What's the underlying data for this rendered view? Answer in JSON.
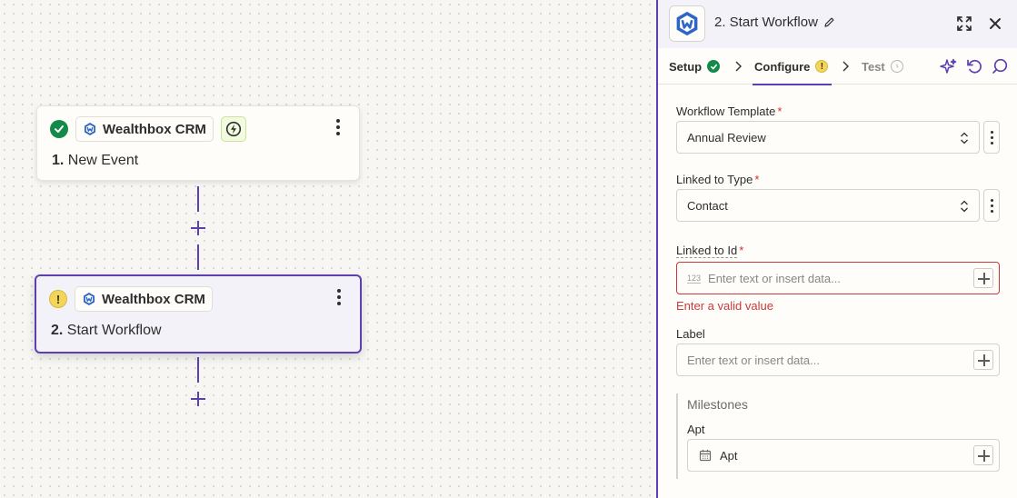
{
  "canvas": {
    "steps": [
      {
        "number": "1.",
        "name": "New Event",
        "app_name": "Wealthbox CRM",
        "status": "complete",
        "status_icon": "check-icon",
        "trigger_icon": "lightning-icon"
      },
      {
        "number": "2.",
        "name": "Start Workflow",
        "app_name": "Wealthbox CRM",
        "status": "warning",
        "status_icon": "warning-icon",
        "status_glyph": "!"
      }
    ]
  },
  "panel": {
    "title": "2. Start Workflow",
    "tabs": [
      {
        "label": "Setup",
        "status_icon": "check-icon"
      },
      {
        "label": "Configure",
        "status_icon": "warning-icon",
        "status_glyph": "!"
      },
      {
        "label": "Test",
        "status_icon": "pending-icon"
      }
    ],
    "fields": {
      "workflow_template": {
        "label": "Workflow Template",
        "required_mark": "*",
        "value": "Annual Review"
      },
      "linked_to_type": {
        "label": "Linked to Type",
        "required_mark": "*",
        "value": "Contact"
      },
      "linked_to_id": {
        "label": "Linked to Id",
        "required_mark": "*",
        "type_badge": "123",
        "placeholder": "Enter text or insert data...",
        "error": "Enter a valid value"
      },
      "label": {
        "label": "Label",
        "placeholder": "Enter text or insert data..."
      }
    },
    "milestones": {
      "title": "Milestones",
      "apt_label": "Apt",
      "apt_value": "Apt"
    }
  },
  "colors": {
    "accent": "#5d3fb0",
    "success": "#138a4a",
    "warning": "#f2d65b",
    "error": "#c93b3b",
    "brand_logo": "#2e66c6"
  }
}
